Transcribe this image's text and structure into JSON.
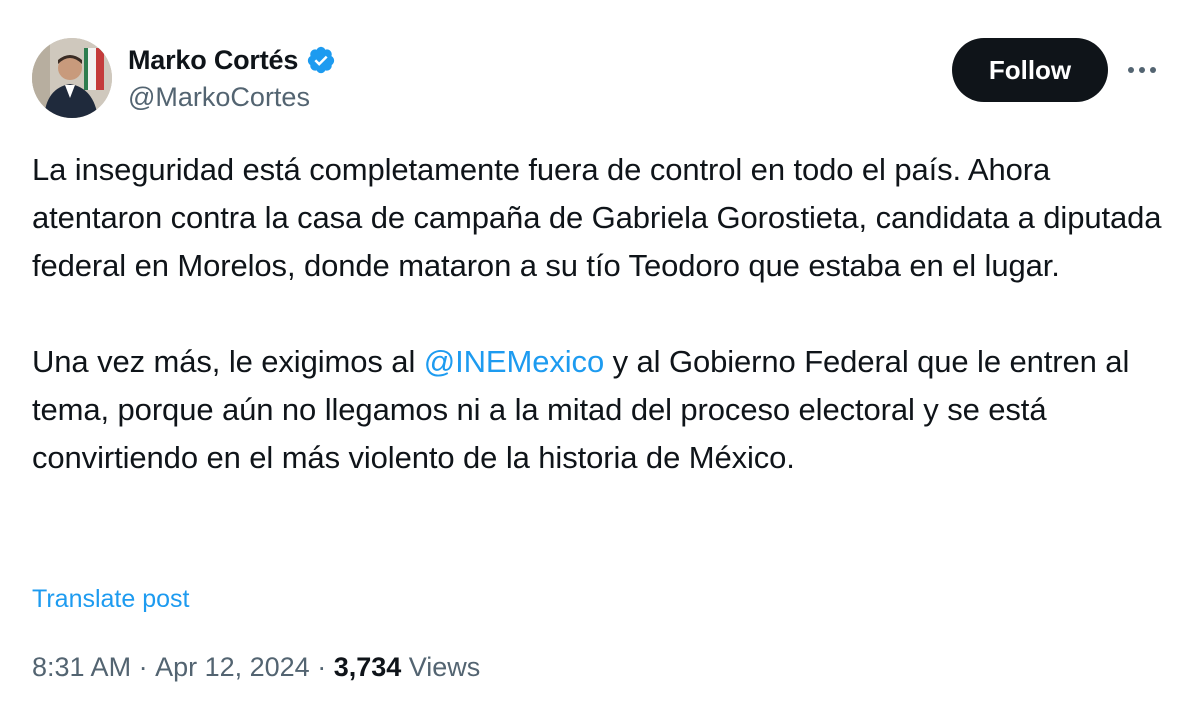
{
  "author": {
    "display_name": "Marko Cortés",
    "handle": "@MarkoCortes",
    "verified": true,
    "verified_color": "#1d9bf0",
    "avatar_icon": "profile-photo"
  },
  "actions": {
    "follow_label": "Follow",
    "more_icon": "ellipsis-horizontal"
  },
  "post": {
    "paragraph_1": "La inseguridad está completamente fuera de control en todo el país. Ahora atentaron contra la casa de campaña de Gabriela Gorostieta, candidata a diputada federal en Morelos, donde mataron a su tío Teodoro que estaba en el lugar.",
    "paragraph_2_before": "Una vez más, le exigimos al ",
    "paragraph_2_mention": "@INEMexico",
    "paragraph_2_after": " y al Gobierno Federal que le entren al tema, porque aún no llegamos ni a la mitad del proceso electoral y se está convirtiendo en el más violento de la historia de México.",
    "translate_label": "Translate post"
  },
  "meta": {
    "time": "8:31 AM",
    "separator": " · ",
    "date": "Apr 12, 2024",
    "views_count": "3,734",
    "views_label": " Views"
  },
  "colors": {
    "text_primary": "#0f1419",
    "text_secondary": "#536471",
    "link": "#1d9bf0",
    "button_bg": "#0f1419"
  }
}
